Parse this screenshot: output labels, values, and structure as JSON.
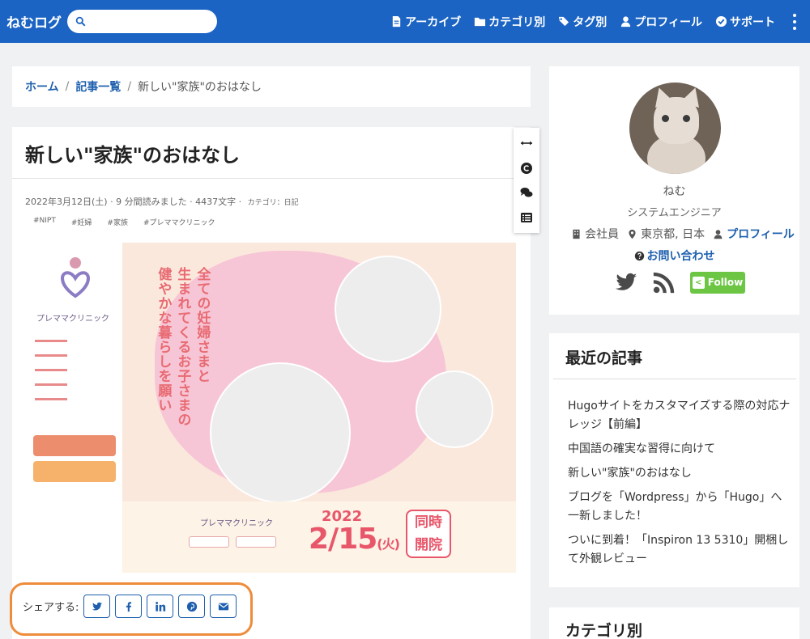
{
  "navbar": {
    "brand": "ねむログ",
    "search_placeholder": "",
    "items": [
      {
        "label": "アーカイブ",
        "icon": "file-icon"
      },
      {
        "label": "カテゴリ別",
        "icon": "folder-icon"
      },
      {
        "label": "タグ別",
        "icon": "tags-icon"
      },
      {
        "label": "プロフィール",
        "icon": "user-icon"
      },
      {
        "label": "サポート",
        "icon": "check-circle-icon"
      }
    ],
    "more_icon": "kebab-menu-icon",
    "color": "#1b64c3"
  },
  "breadcrumb": {
    "home": "ホーム",
    "list": "記事一覧",
    "current": "新しい\"家族\"のおはなし",
    "separator": "/"
  },
  "article": {
    "title": "新しい\"家族\"のおはなし",
    "date": "2022年3月12日(土)",
    "read_time": "9 分間読みました",
    "chars": "4437文字",
    "category_label": "カテゴリ：日記",
    "meta_sep": "·",
    "tags": [
      "#NIPT",
      "#妊婦",
      "#家族",
      "#プレママクリニック"
    ]
  },
  "toolbar": {
    "items": [
      "arrows-h-icon",
      "copyright-icon",
      "comments-icon",
      "list-icon"
    ]
  },
  "hero": {
    "vertical_lines": [
      "全ての妊婦さまと",
      "生まれてくるお子さまの",
      "健やかな暮らしを願い"
    ],
    "clinic_name": "プレママクリニック",
    "year": "2022",
    "date": "2/15",
    "weekday": "(火)",
    "badge_line1": "同時",
    "badge_line2": "開院"
  },
  "share": {
    "label": "シェアする:",
    "buttons": [
      "twitter-icon",
      "facebook-icon",
      "linkedin-icon",
      "pinterest-icon",
      "email-icon"
    ],
    "highlight_color": "#ee8c3b"
  },
  "profile": {
    "name": "ねむ",
    "role": "システムエンジニア",
    "company": "会社員",
    "location": "東京都, 日本",
    "profile_link": "プロフィール",
    "contact": "お問い合わせ",
    "follow": "Follow",
    "follow_mark": "<"
  },
  "recent": {
    "title": "最近の記事",
    "items": [
      "Hugoサイトをカスタマイズする際の対応ナレッジ【前編】",
      "中国語の確実な習得に向けて",
      "新しい\"家族\"のおはなし",
      "ブログを「Wordpress」から「Hugo」へ一新しました！",
      "ついに到着！「Inspiron 13 5310」開梱して外観レビュー"
    ]
  },
  "categories": {
    "title": "カテゴリ別"
  }
}
